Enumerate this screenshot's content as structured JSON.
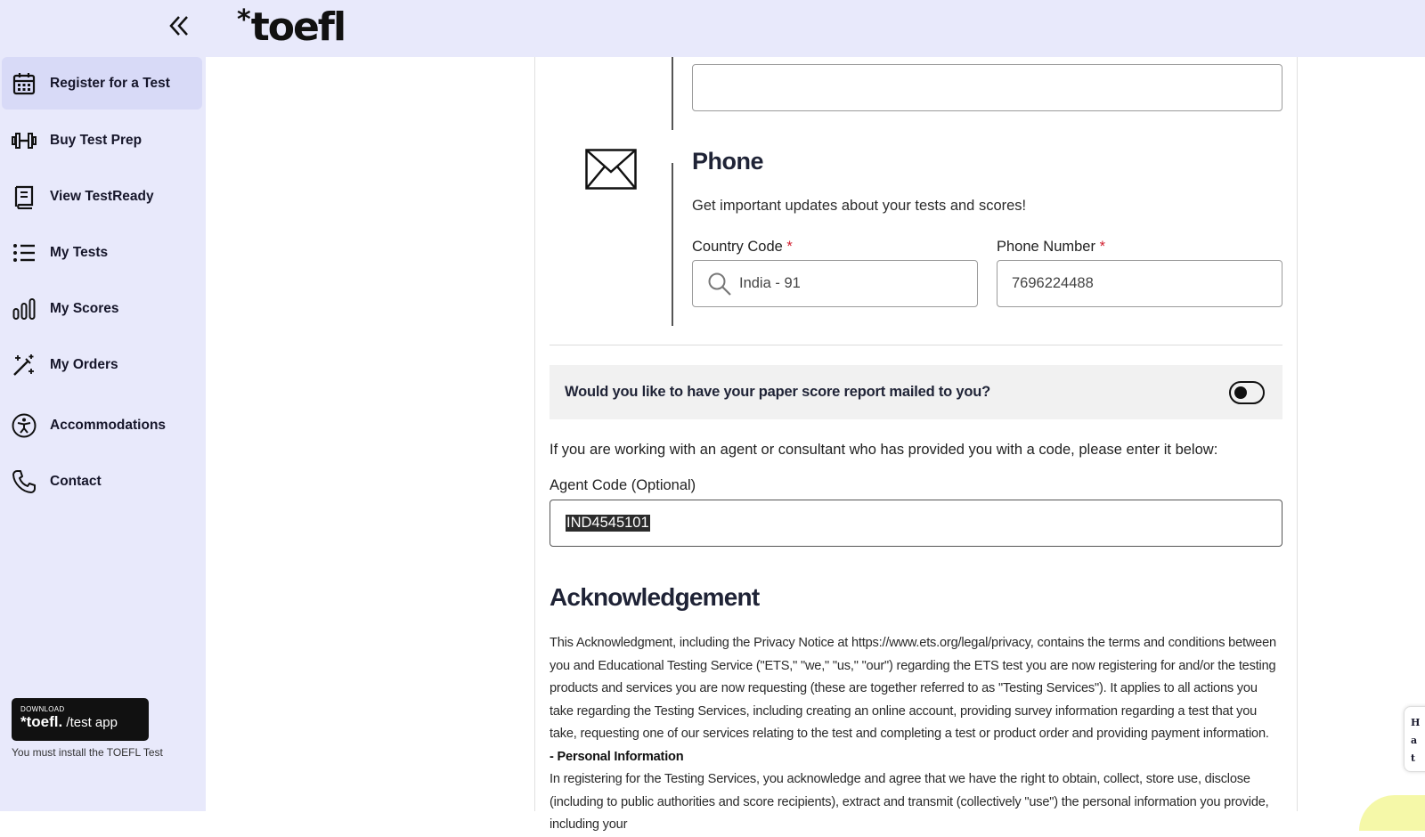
{
  "header": {
    "logo_star": "*",
    "logo_text": "toefl"
  },
  "sidebar": {
    "items": [
      {
        "label": "Register for a Test",
        "icon": "calendar-icon",
        "active": true
      },
      {
        "label": "Buy Test Prep",
        "icon": "dumbbell-icon",
        "active": false
      },
      {
        "label": "View TestReady",
        "icon": "book-icon",
        "active": false
      },
      {
        "label": "My Tests",
        "icon": "list-icon",
        "active": false
      },
      {
        "label": "My Scores",
        "icon": "bar-chart-icon",
        "active": false
      },
      {
        "label": "My Orders",
        "icon": "magic-wand-icon",
        "active": false
      },
      {
        "label": "Accommodations",
        "icon": "accessibility-icon",
        "active": false
      },
      {
        "label": "Contact",
        "icon": "phone-icon",
        "active": false
      }
    ],
    "download_small": "DOWNLOAD",
    "download_logo": "*toefl.",
    "download_app": " /test app",
    "note": "You must install the TOEFL Test"
  },
  "phone_section": {
    "title": "Phone",
    "subtitle": "Get important updates about your tests and scores!",
    "country_code_label": "Country Code",
    "country_code_value": "India - 91",
    "phone_number_label": "Phone Number",
    "phone_number_value": "7696224488",
    "required_mark": "*"
  },
  "paper_report": {
    "question": "Would you like to have your paper score report mailed to you?",
    "enabled": false
  },
  "agent": {
    "note": "If you are working with an agent or consultant who has provided you with a code, please enter it below:",
    "label": "Agent Code (Optional)",
    "value": "IND4545101"
  },
  "acknowledgement": {
    "title": "Acknowledgement",
    "paragraph1": "This Acknowledgment, including the Privacy Notice at https://www.ets.org/legal/privacy, contains the terms and conditions between you and Educational Testing Service (\"ETS,\" \"we,\" \"us,\" \"our\") regarding the ETS test you are now registering for and/or the testing products and services you are now requesting (these are together referred to as \"Testing Services\"). It applies to all actions you take regarding the Testing Services, including creating an online account, providing survey information regarding a test that you take, requesting one of our services relating to the test and completing a test or product order and providing payment information.",
    "heading2": "- Personal Information",
    "paragraph2": "In registering for the Testing Services, you acknowledge and agree that we have the right to obtain, collect, store use, disclose (including to public authorities and score recipients), extract and transmit (collectively \"use\") the personal information you provide, including your"
  },
  "side_widget": {
    "lines": [
      "H",
      "a",
      "t"
    ]
  },
  "colors": {
    "sidebar_bg": "#e8e9fb",
    "active_item_bg": "#d8daf7",
    "required": "#d11f2f",
    "question_bg": "#f1f1f1"
  }
}
